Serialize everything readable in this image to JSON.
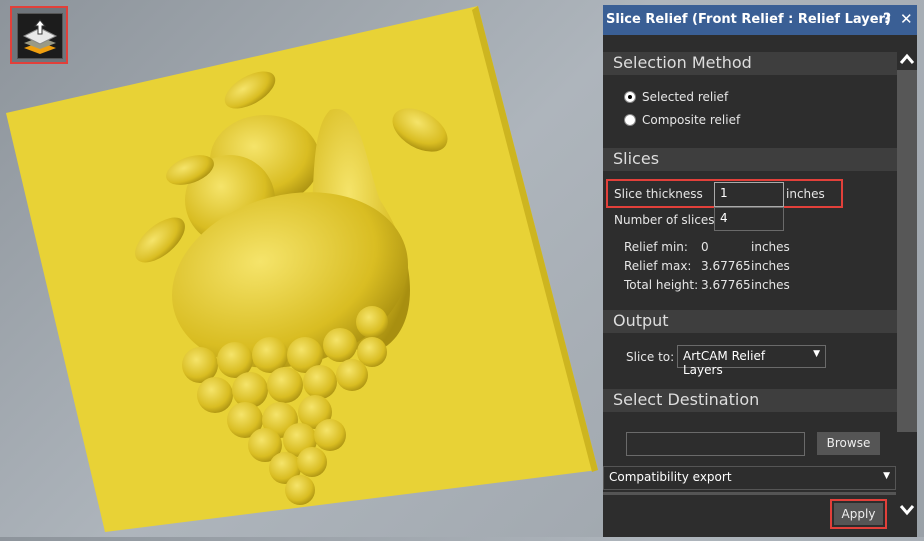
{
  "panel": {
    "title": "Slice Relief (Front Relief : Relief Layer)",
    "help_label": "?",
    "close_label": "✕",
    "selection_method": {
      "header": "Selection Method",
      "options": [
        {
          "label": "Selected relief",
          "selected": true
        },
        {
          "label": "Composite relief",
          "selected": false
        }
      ]
    },
    "slices": {
      "header": "Slices",
      "thickness_label": "Slice thickness",
      "thickness_value": "1",
      "thickness_unit": "inches",
      "count_label": "Number of slices",
      "count_value": "4",
      "relief_min_label": "Relief min:",
      "relief_min_value": "0",
      "relief_min_unit": "inches",
      "relief_max_label": "Relief max:",
      "relief_max_value": "3.67765",
      "relief_max_unit": "inches",
      "total_height_label": "Total height:",
      "total_height_value": "3.67765",
      "total_height_unit": "inches"
    },
    "output": {
      "header": "Output",
      "slice_to_label": "Slice to:",
      "slice_to_value": "ArtCAM Relief Layers"
    },
    "destination": {
      "header": "Select Destination",
      "path_value": "",
      "browse_label": "Browse",
      "export_mode": "Compatibility export"
    },
    "apply_label": "Apply"
  },
  "colors": {
    "title_bar": "#3a5f95",
    "highlight": "#e2403a",
    "relief": "#e6cf32"
  }
}
